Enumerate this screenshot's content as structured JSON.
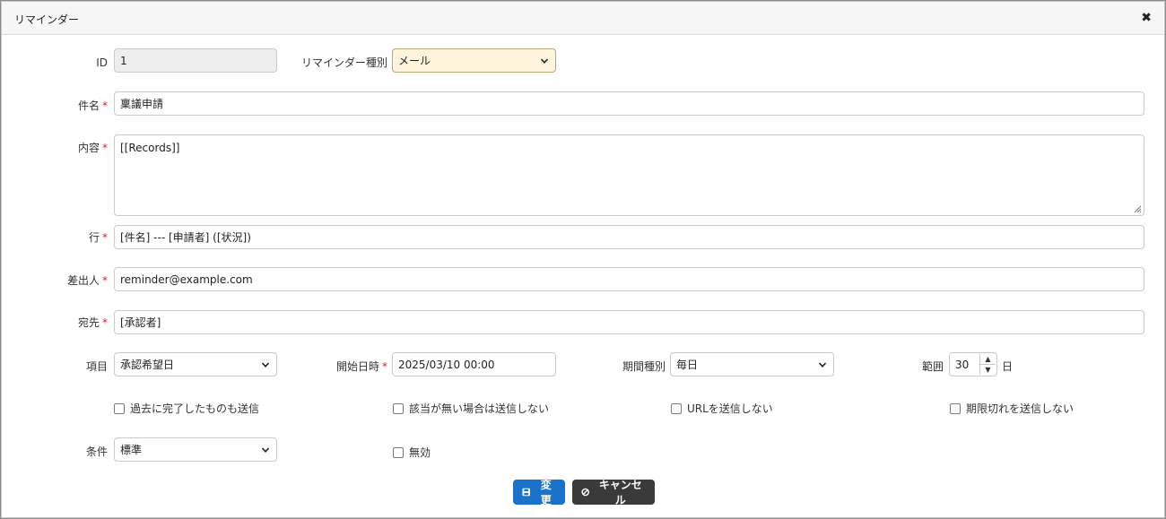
{
  "dialog": {
    "title": "リマインダー",
    "close": "✖"
  },
  "fields": {
    "id": {
      "label": "ID",
      "value": "1"
    },
    "reminder_type": {
      "label": "リマインダー種別",
      "value": "メール"
    },
    "subject": {
      "label": "件名",
      "value": "稟議申請"
    },
    "body": {
      "label": "内容",
      "value": "[[Records]]"
    },
    "line": {
      "label": "行",
      "value": "[件名] --- [申請者] ([状況])"
    },
    "from": {
      "label": "差出人",
      "value": "reminder@example.com"
    },
    "to": {
      "label": "宛先",
      "value": "[承認者]"
    },
    "column": {
      "label": "項目",
      "value": "承認希望日"
    },
    "start_datetime": {
      "label": "開始日時",
      "value": "2025/03/10 00:00"
    },
    "period_type": {
      "label": "期間種別",
      "value": "毎日"
    },
    "range": {
      "label": "範囲",
      "value": "30",
      "unit": "日"
    },
    "condition": {
      "label": "条件",
      "value": "標準"
    }
  },
  "required_mark": "*",
  "checkboxes": {
    "send_completed": {
      "label": "過去に完了したものも送信",
      "checked": false
    },
    "not_send_no_data": {
      "label": "該当が無い場合は送信しない",
      "checked": false
    },
    "not_send_url": {
      "label": "URLを送信しない",
      "checked": false
    },
    "exclude_overdue": {
      "label": "期限切れを送信しない",
      "checked": false
    },
    "disabled": {
      "label": "無効",
      "checked": false
    }
  },
  "buttons": {
    "update": {
      "label": "変更",
      "icon": "save-icon",
      "color": "#1a73c8"
    },
    "cancel": {
      "label": "キャンセル",
      "icon": "cancel-icon",
      "color": "#3a3a3a"
    }
  }
}
